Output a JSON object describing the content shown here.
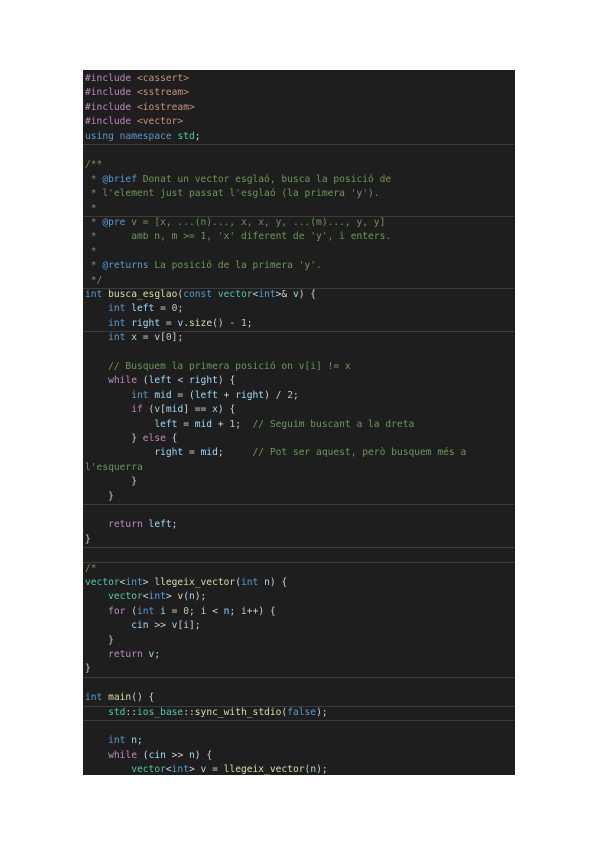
{
  "code": {
    "lines": [
      [
        {
          "t": "#include",
          "c": "pp"
        },
        {
          "t": " "
        },
        {
          "t": "<cassert>",
          "c": "inc"
        }
      ],
      [
        {
          "t": "#include",
          "c": "pp"
        },
        {
          "t": " "
        },
        {
          "t": "<sstream>",
          "c": "inc"
        }
      ],
      [
        {
          "t": "#include",
          "c": "pp"
        },
        {
          "t": " "
        },
        {
          "t": "<iostream>",
          "c": "inc"
        }
      ],
      [
        {
          "t": "#include",
          "c": "pp"
        },
        {
          "t": " "
        },
        {
          "t": "<vector>",
          "c": "inc"
        }
      ],
      [
        {
          "t": "using",
          "c": "kw"
        },
        {
          "t": " "
        },
        {
          "t": "namespace",
          "c": "kw"
        },
        {
          "t": " "
        },
        {
          "t": "std",
          "c": "type"
        },
        {
          "t": ";"
        }
      ],
      [],
      [
        {
          "t": "/**",
          "c": "cm"
        }
      ],
      [
        {
          "t": " * ",
          "c": "cm"
        },
        {
          "t": "@brief",
          "c": "tag"
        },
        {
          "t": " Donat un vector esglaó, busca la posició de",
          "c": "cm"
        }
      ],
      [
        {
          "t": " * l'element just passat l'esglaó (la primera 'y').",
          "c": "cm"
        }
      ],
      [
        {
          "t": " *",
          "c": "cm"
        }
      ],
      [
        {
          "t": " * ",
          "c": "cm"
        },
        {
          "t": "@pre",
          "c": "tag"
        },
        {
          "t": " v = [x, ...(n)..., x, x, y, ...(m)..., y, y]",
          "c": "cm"
        }
      ],
      [
        {
          "t": " *      amb n, m >= 1, 'x' diferent de 'y', i enters.",
          "c": "cm"
        }
      ],
      [
        {
          "t": " *",
          "c": "cm"
        }
      ],
      [
        {
          "t": " * ",
          "c": "cm"
        },
        {
          "t": "@returns",
          "c": "tag"
        },
        {
          "t": " La posició de la primera 'y'.",
          "c": "cm"
        }
      ],
      [
        {
          "t": " */",
          "c": "cm"
        }
      ],
      [
        {
          "t": "int",
          "c": "kw"
        },
        {
          "t": " "
        },
        {
          "t": "busca_esglao",
          "c": "fn"
        },
        {
          "t": "("
        },
        {
          "t": "const",
          "c": "kw"
        },
        {
          "t": " "
        },
        {
          "t": "vector",
          "c": "type"
        },
        {
          "t": "<"
        },
        {
          "t": "int",
          "c": "kw"
        },
        {
          "t": ">& "
        },
        {
          "t": "v",
          "c": "var"
        },
        {
          "t": ") {"
        }
      ],
      [
        {
          "t": "    "
        },
        {
          "t": "int",
          "c": "kw"
        },
        {
          "t": " "
        },
        {
          "t": "left",
          "c": "var"
        },
        {
          "t": " = "
        },
        {
          "t": "0",
          "c": "num"
        },
        {
          "t": ";"
        }
      ],
      [
        {
          "t": "    "
        },
        {
          "t": "int",
          "c": "kw"
        },
        {
          "t": " "
        },
        {
          "t": "right",
          "c": "var"
        },
        {
          "t": " = "
        },
        {
          "t": "v",
          "c": "var"
        },
        {
          "t": "."
        },
        {
          "t": "size",
          "c": "fn"
        },
        {
          "t": "() - "
        },
        {
          "t": "1",
          "c": "num"
        },
        {
          "t": ";"
        }
      ],
      [
        {
          "t": "    "
        },
        {
          "t": "int",
          "c": "kw"
        },
        {
          "t": " "
        },
        {
          "t": "x",
          "c": "var"
        },
        {
          "t": " = "
        },
        {
          "t": "v",
          "c": "var"
        },
        {
          "t": "["
        },
        {
          "t": "0",
          "c": "num"
        },
        {
          "t": "];"
        }
      ],
      [],
      [
        {
          "t": "    // Busquem la primera posició on v[i] != x",
          "c": "cm"
        }
      ],
      [
        {
          "t": "    "
        },
        {
          "t": "while",
          "c": "ctl"
        },
        {
          "t": " ("
        },
        {
          "t": "left",
          "c": "var"
        },
        {
          "t": " < "
        },
        {
          "t": "right",
          "c": "var"
        },
        {
          "t": ") {"
        }
      ],
      [
        {
          "t": "        "
        },
        {
          "t": "int",
          "c": "kw"
        },
        {
          "t": " "
        },
        {
          "t": "mid",
          "c": "var"
        },
        {
          "t": " = ("
        },
        {
          "t": "left",
          "c": "var"
        },
        {
          "t": " + "
        },
        {
          "t": "right",
          "c": "var"
        },
        {
          "t": ") / "
        },
        {
          "t": "2",
          "c": "num"
        },
        {
          "t": ";"
        }
      ],
      [
        {
          "t": "        "
        },
        {
          "t": "if",
          "c": "ctl"
        },
        {
          "t": " ("
        },
        {
          "t": "v",
          "c": "var"
        },
        {
          "t": "["
        },
        {
          "t": "mid",
          "c": "var"
        },
        {
          "t": "] == "
        },
        {
          "t": "x",
          "c": "var"
        },
        {
          "t": ") {"
        }
      ],
      [
        {
          "t": "            "
        },
        {
          "t": "left",
          "c": "var"
        },
        {
          "t": " = "
        },
        {
          "t": "mid",
          "c": "var"
        },
        {
          "t": " + "
        },
        {
          "t": "1",
          "c": "num"
        },
        {
          "t": ";  "
        },
        {
          "t": "// Seguim buscant a la dreta",
          "c": "cm"
        }
      ],
      [
        {
          "t": "        } "
        },
        {
          "t": "else",
          "c": "ctl"
        },
        {
          "t": " {"
        }
      ],
      [
        {
          "t": "            "
        },
        {
          "t": "right",
          "c": "var"
        },
        {
          "t": " = "
        },
        {
          "t": "mid",
          "c": "var"
        },
        {
          "t": ";     "
        },
        {
          "t": "// Pot ser aquest, però busquem més a",
          "c": "cm"
        }
      ],
      [
        {
          "t": "l'esquerra",
          "c": "cm"
        }
      ],
      [
        {
          "t": "        }"
        }
      ],
      [
        {
          "t": "    }"
        }
      ],
      [],
      [
        {
          "t": "    "
        },
        {
          "t": "return",
          "c": "ctl"
        },
        {
          "t": " "
        },
        {
          "t": "left",
          "c": "var"
        },
        {
          "t": ";"
        }
      ],
      [
        {
          "t": "}"
        }
      ],
      [],
      [
        {
          "t": "/*",
          "c": "cm"
        }
      ],
      [
        {
          "t": "vector",
          "c": "type"
        },
        {
          "t": "<"
        },
        {
          "t": "int",
          "c": "kw"
        },
        {
          "t": "> "
        },
        {
          "t": "llegeix_vector",
          "c": "fn"
        },
        {
          "t": "("
        },
        {
          "t": "int",
          "c": "kw"
        },
        {
          "t": " "
        },
        {
          "t": "n",
          "c": "var"
        },
        {
          "t": ") {"
        }
      ],
      [
        {
          "t": "    "
        },
        {
          "t": "vector",
          "c": "type"
        },
        {
          "t": "<"
        },
        {
          "t": "int",
          "c": "kw"
        },
        {
          "t": "> "
        },
        {
          "t": "v",
          "c": "fn"
        },
        {
          "t": "("
        },
        {
          "t": "n",
          "c": "var"
        },
        {
          "t": ");"
        }
      ],
      [
        {
          "t": "    "
        },
        {
          "t": "for",
          "c": "ctl"
        },
        {
          "t": " ("
        },
        {
          "t": "int",
          "c": "kw"
        },
        {
          "t": " "
        },
        {
          "t": "i",
          "c": "var"
        },
        {
          "t": " = "
        },
        {
          "t": "0",
          "c": "num"
        },
        {
          "t": "; "
        },
        {
          "t": "i",
          "c": "var"
        },
        {
          "t": " < "
        },
        {
          "t": "n",
          "c": "var"
        },
        {
          "t": "; "
        },
        {
          "t": "i",
          "c": "var"
        },
        {
          "t": "++) {"
        }
      ],
      [
        {
          "t": "        "
        },
        {
          "t": "cin",
          "c": "var"
        },
        {
          "t": " >> "
        },
        {
          "t": "v",
          "c": "var"
        },
        {
          "t": "["
        },
        {
          "t": "i",
          "c": "var"
        },
        {
          "t": "];"
        }
      ],
      [
        {
          "t": "    }"
        }
      ],
      [
        {
          "t": "    "
        },
        {
          "t": "return",
          "c": "ctl"
        },
        {
          "t": " "
        },
        {
          "t": "v",
          "c": "var"
        },
        {
          "t": ";"
        }
      ],
      [
        {
          "t": "}"
        }
      ],
      [],
      [
        {
          "t": "int",
          "c": "kw"
        },
        {
          "t": " "
        },
        {
          "t": "main",
          "c": "fn"
        },
        {
          "t": "() {"
        }
      ],
      [
        {
          "t": "    "
        },
        {
          "t": "std",
          "c": "type"
        },
        {
          "t": "::"
        },
        {
          "t": "ios_base",
          "c": "type"
        },
        {
          "t": "::"
        },
        {
          "t": "sync_with_stdio",
          "c": "fn"
        },
        {
          "t": "("
        },
        {
          "t": "false",
          "c": "kw"
        },
        {
          "t": ");"
        }
      ],
      [],
      [
        {
          "t": "    "
        },
        {
          "t": "int",
          "c": "kw"
        },
        {
          "t": " "
        },
        {
          "t": "n",
          "c": "var"
        },
        {
          "t": ";"
        }
      ],
      [
        {
          "t": "    "
        },
        {
          "t": "while",
          "c": "ctl"
        },
        {
          "t": " ("
        },
        {
          "t": "cin",
          "c": "var"
        },
        {
          "t": " >> "
        },
        {
          "t": "n",
          "c": "var"
        },
        {
          "t": ") {"
        }
      ],
      [
        {
          "t": "        "
        },
        {
          "t": "vector",
          "c": "type"
        },
        {
          "t": "<"
        },
        {
          "t": "int",
          "c": "kw"
        },
        {
          "t": "> "
        },
        {
          "t": "v",
          "c": "var"
        },
        {
          "t": " = "
        },
        {
          "t": "llegeix_vector",
          "c": "fn"
        },
        {
          "t": "("
        },
        {
          "t": "n",
          "c": "var"
        },
        {
          "t": ");"
        }
      ]
    ]
  },
  "theme": {
    "background": "#1e1e1e",
    "page_background": "#ffffff",
    "keyword": "#569cd6",
    "control": "#c586c0",
    "type": "#4ec9b0",
    "function": "#dcdcaa",
    "variable": "#9cdcfe",
    "number": "#b5cea8",
    "comment": "#6a9955",
    "string": "#ce9178"
  }
}
